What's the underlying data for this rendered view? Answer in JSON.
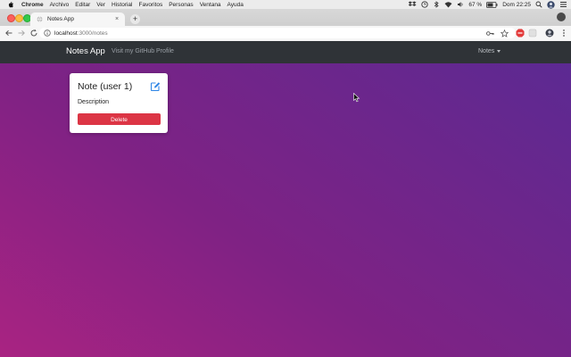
{
  "menubar": {
    "app": "Chrome",
    "items": [
      "Archivo",
      "Editar",
      "Ver",
      "Historial",
      "Favoritos",
      "Personas",
      "Ventana",
      "Ayuda"
    ],
    "battery": "67 %",
    "clock": "Dom 22:25"
  },
  "browser": {
    "tab_title": "Notes App",
    "close_glyph": "×",
    "new_tab_glyph": "+",
    "url_host": "localhost",
    "url_path": ":3000/notes"
  },
  "navbar": {
    "brand": "Notes App",
    "github_link": "Visit my GitHub Profile",
    "dropdown": "Notes"
  },
  "notes": [
    {
      "title": "Note (user 1)",
      "description": "Description",
      "delete_label": "Delete"
    }
  ],
  "colors": {
    "navbar": "#2f3337",
    "delete": "#dc3545",
    "edit_icon": "#2f86e6",
    "gradient_start": "#a92382",
    "gradient_end": "#5a2a93"
  }
}
